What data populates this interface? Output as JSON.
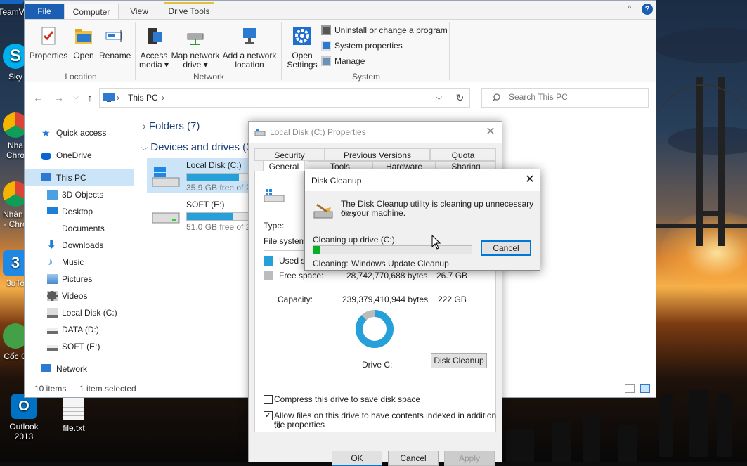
{
  "desktop": {
    "icons": [
      {
        "label": "TeamV",
        "color": "#1565c0"
      },
      {
        "label": "Sky",
        "color": "#00aff0"
      },
      {
        "label": "Nha\nChro",
        "color": "#db4437"
      },
      {
        "label": "Nhân (\n- Chro",
        "color": "#db4437"
      },
      {
        "label": "3uTo",
        "color": "#1e88e5"
      },
      {
        "label": "Cốc C",
        "color": "#43a047"
      },
      {
        "label": "Outlook 2013",
        "color": "#0072c6"
      },
      {
        "label": "file.txt",
        "color": "#f5f5f5"
      }
    ]
  },
  "explorer": {
    "tabs": {
      "file": "File",
      "computer": "Computer",
      "view": "View",
      "drive_tools": "Drive Tools"
    },
    "ribbon": {
      "location": {
        "properties": "Properties",
        "open": "Open",
        "rename": "Rename",
        "label": "Location"
      },
      "network": {
        "access_media_1": "Access",
        "access_media_2": "media ▾",
        "map_drive_1": "Map network",
        "map_drive_2": "drive ▾",
        "add_location_1": "Add a network",
        "add_location_2": "location",
        "label": "Network"
      },
      "system": {
        "open_settings_1": "Open",
        "open_settings_2": "Settings",
        "uninstall": "Uninstall or change a program",
        "system_properties": "System properties",
        "manage": "Manage",
        "label": "System"
      }
    },
    "address": {
      "location": "This PC",
      "separator": "›"
    },
    "search": {
      "placeholder": "Search This PC"
    },
    "sidebar": [
      {
        "label": "Quick access",
        "icon": "star-icon",
        "color": "#2b79d0"
      },
      {
        "label": "OneDrive",
        "icon": "cloud-icon",
        "color": "#0a64d2"
      },
      {
        "label": "This PC",
        "icon": "computer-icon",
        "color": "#2b79d0"
      },
      {
        "label": "3D Objects",
        "icon": "cube-icon",
        "color": "#4aa0e0"
      },
      {
        "label": "Desktop",
        "icon": "desktop-icon",
        "color": "#1e7fd6"
      },
      {
        "label": "Documents",
        "icon": "document-icon",
        "color": "#8a8a8a"
      },
      {
        "label": "Downloads",
        "icon": "download-icon",
        "color": "#1e7fd6"
      },
      {
        "label": "Music",
        "icon": "music-icon",
        "color": "#1e7fd6"
      },
      {
        "label": "Pictures",
        "icon": "picture-icon",
        "color": "#4a88c8"
      },
      {
        "label": "Videos",
        "icon": "video-icon",
        "color": "#5a5a5a"
      },
      {
        "label": "Local Disk (C:)",
        "icon": "drive-icon",
        "color": "#6c6c6c"
      },
      {
        "label": "DATA (D:)",
        "icon": "drive-icon",
        "color": "#6c6c6c"
      },
      {
        "label": "SOFT (E:)",
        "icon": "drive-icon",
        "color": "#6c6c6c"
      },
      {
        "label": "Network",
        "icon": "network-icon",
        "color": "#2b79d0"
      }
    ],
    "sections": {
      "folders": "Folders (7)",
      "devices": "Devices and drives (3"
    },
    "drives": [
      {
        "name": "Local Disk (C:)",
        "free": "35.9 GB free of 2",
        "used_fraction": 0.84
      },
      {
        "name": "SOFT (E:)",
        "free": "51.0 GB free of 20",
        "used_fraction": 0.75
      }
    ],
    "status": {
      "items": "10 items",
      "selected": "1 item selected"
    }
  },
  "properties": {
    "title": "Local Disk (C:) Properties",
    "tabs_row1": [
      "Security",
      "Previous Versions",
      "Quota"
    ],
    "tabs_row2": [
      "General",
      "Tools",
      "Hardware",
      "Sharing"
    ],
    "type_label": "Type:",
    "fs_label": "File system:",
    "used_label": "Used sp",
    "free_label": "Free space:",
    "free_bytes": "28,742,770,688 bytes",
    "free_gb": "26.7 GB",
    "capacity_label": "Capacity:",
    "capacity_bytes": "239,379,410,944 bytes",
    "capacity_gb": "222 GB",
    "drive_label": "Drive C:",
    "disk_cleanup_button": "Disk Cleanup",
    "used_fraction": 0.88,
    "colors": {
      "used": "#26a0da",
      "free": "#bcbcbc"
    },
    "compress": {
      "label": "Compress this drive to save disk space",
      "checked": false
    },
    "index": {
      "label_1": "Allow files on this drive to have contents indexed in addition to",
      "label_2": "file properties",
      "checked": true
    },
    "ok": "OK",
    "cancel": "Cancel",
    "apply": "Apply"
  },
  "cleanup": {
    "title": "Disk Cleanup",
    "message_1": "The Disk Cleanup utility is cleaning up unnecessary files",
    "message_2": "on your machine.",
    "progress_label": "Cleaning up drive  (C:).",
    "progress_fraction": 0.04,
    "cleaning_label": "Cleaning:",
    "cleaning_item": "Windows Update Cleanup",
    "cancel": "Cancel"
  }
}
